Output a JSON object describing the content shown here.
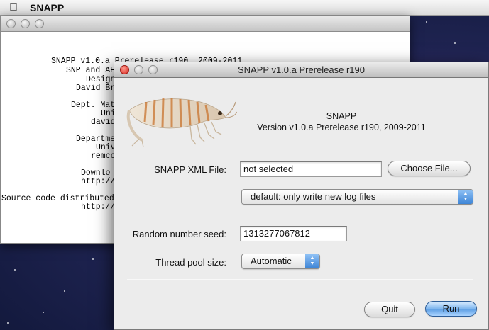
{
  "menubar": {
    "apple_icon": "apple-icon",
    "app_name": "SNAPP"
  },
  "console_window": {
    "lines": [
      "SNAPP v1.0.a Prerelease r190, 2009-2011",
      "SNP and AFLP Phylogenetic analysis",
      "Designed and developed by",
      "David Br",
      "Dept. Mat",
      "Uni",
      "david",
      "Departme",
      "Univ",
      "remco",
      "Downlo",
      "http://",
      "Source code distributed",
      "http://"
    ]
  },
  "dialog": {
    "title": "SNAPP v1.0.a Prerelease r190",
    "image_icon": "shrimp-logo",
    "app_name": "SNAPP",
    "version": "Version v1.0.a Prerelease r190, 2009-2011",
    "xml_file_label": "SNAPP XML File:",
    "xml_file_value": "not selected",
    "choose_file_button": "Choose File...",
    "log_mode_selected": "default: only write new log files",
    "seed_label": "Random number seed:",
    "seed_value": "1313277067812",
    "thread_pool_label": "Thread pool size:",
    "thread_pool_selected": "Automatic",
    "quit_button": "Quit",
    "run_button": "Run"
  },
  "colors": {
    "desktop": "#1e2350",
    "dialog_bg": "#ececec",
    "default_button": "#5a9ce3",
    "close_button": "#d4241b"
  }
}
